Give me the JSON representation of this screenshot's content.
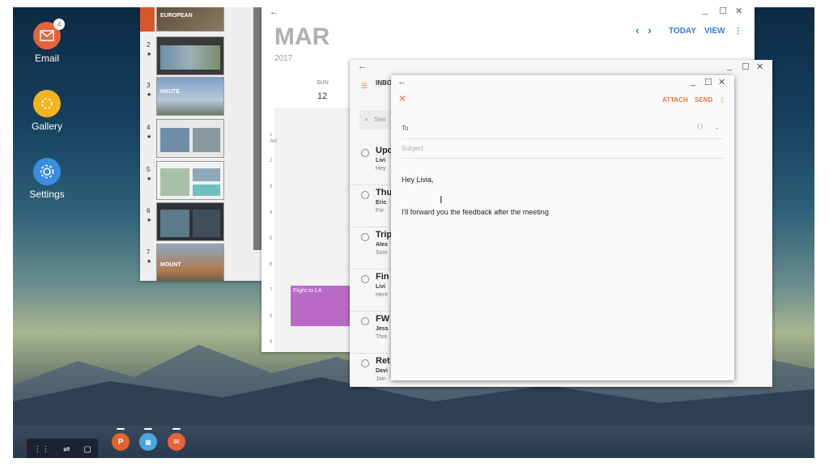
{
  "desktop": {
    "icons": [
      {
        "label": "Email",
        "badge": "4",
        "color": "#e8623a"
      },
      {
        "label": "Gallery",
        "color": "#f2b51c"
      },
      {
        "label": "Settings",
        "color": "#3a8de0"
      }
    ]
  },
  "slides": {
    "rows": [
      {
        "num": "2",
        "star": "★",
        "title": ""
      },
      {
        "num": "3",
        "star": "★",
        "title": "HAUTE"
      },
      {
        "num": "4",
        "star": "★",
        "title": ""
      },
      {
        "num": "5",
        "star": "★",
        "title": ""
      },
      {
        "num": "6",
        "star": "★",
        "title": ""
      },
      {
        "num": "7",
        "star": "★",
        "title": "MOUNT"
      }
    ],
    "first_title": "EUROPEAN"
  },
  "calendar": {
    "month": "MAR",
    "year": "2017",
    "today_label": "TODAY",
    "view_label": "VIEW",
    "day_name": "SUN",
    "day_num": "12",
    "hours": [
      "1",
      "2",
      "3",
      "4",
      "5",
      "6",
      "7",
      "8",
      "9"
    ],
    "event_label": "Flight to LA",
    "am_label": "AM"
  },
  "inbox": {
    "title": "INBO",
    "search_placeholder": "Sea",
    "items": [
      {
        "subject": "Upc",
        "from": "Livi",
        "preview": "Hey"
      },
      {
        "subject": "Thu",
        "from": "Eric",
        "preview": "For "
      },
      {
        "subject": "Trip",
        "from": "Alex",
        "preview": "Sum"
      },
      {
        "subject": "Fin",
        "from": "Livi",
        "preview": "Here"
      },
      {
        "subject": "FW",
        "from": "Jess",
        "preview": "Thot"
      },
      {
        "subject": "Ret",
        "from": "Davi",
        "preview": "Join"
      }
    ]
  },
  "compose": {
    "attach_label": "ATTACH",
    "send_label": "SEND",
    "to_placeholder": "To",
    "subject_placeholder": "Subject",
    "greeting": "Hey Livia,",
    "body": "I'll forward you the feedback after the meeting"
  },
  "colors": {
    "accent_orange": "#e8773f",
    "accent_blue": "#2f7fd0",
    "event_purple": "#b96ac7"
  }
}
